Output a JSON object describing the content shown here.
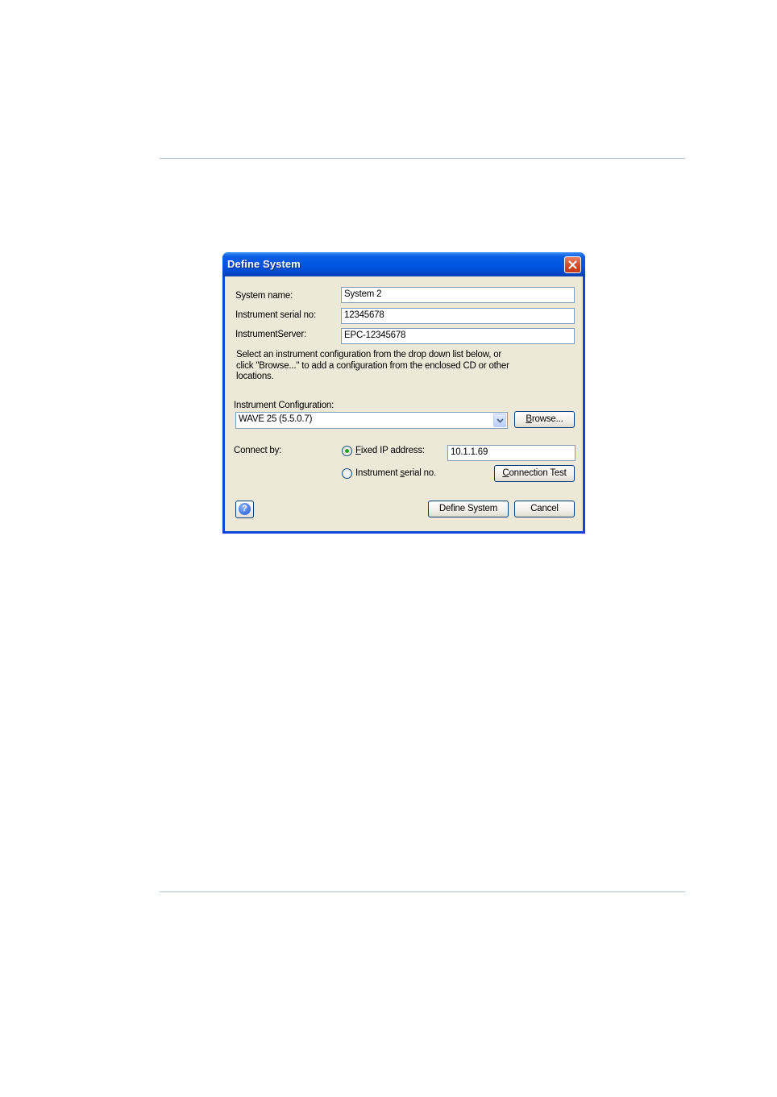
{
  "dialog": {
    "title": "Define System",
    "fields": {
      "system_name_label": "System name:",
      "system_name_value": "System 2",
      "serial_label": "Instrument serial no:",
      "serial_value": "12345678",
      "server_label": "InstrumentServer:",
      "server_value": "EPC-12345678"
    },
    "description": "Select an instrument configuration from the drop down list below, or click \"Browse...\" to add a configuration from the enclosed CD or other locations.",
    "config": {
      "label": "Instrument Configuration:",
      "selected": "WAVE 25 (5.5.0.7)",
      "browse_prefix": "",
      "browse_key": "B",
      "browse_rest": "rowse..."
    },
    "connect": {
      "label": "Connect by:",
      "fixed_ip_key": "F",
      "fixed_ip_rest": "ixed IP address:",
      "fixed_ip_selected": true,
      "ip_value": "10.1.1.69",
      "serial_prefix": "Instrument ",
      "serial_key": "s",
      "serial_rest": "erial no.",
      "test_key": "C",
      "test_rest": "onnection Test"
    },
    "buttons": {
      "define": "Define System",
      "cancel": "Cancel"
    },
    "icons": {
      "close": "close-icon",
      "help": "help-icon",
      "dropdown": "chevron-down-icon"
    },
    "colors": {
      "titlebar": "#0055e5",
      "body": "#ece9d8",
      "close": "#d4461f",
      "radio_dot": "#21a121"
    }
  }
}
